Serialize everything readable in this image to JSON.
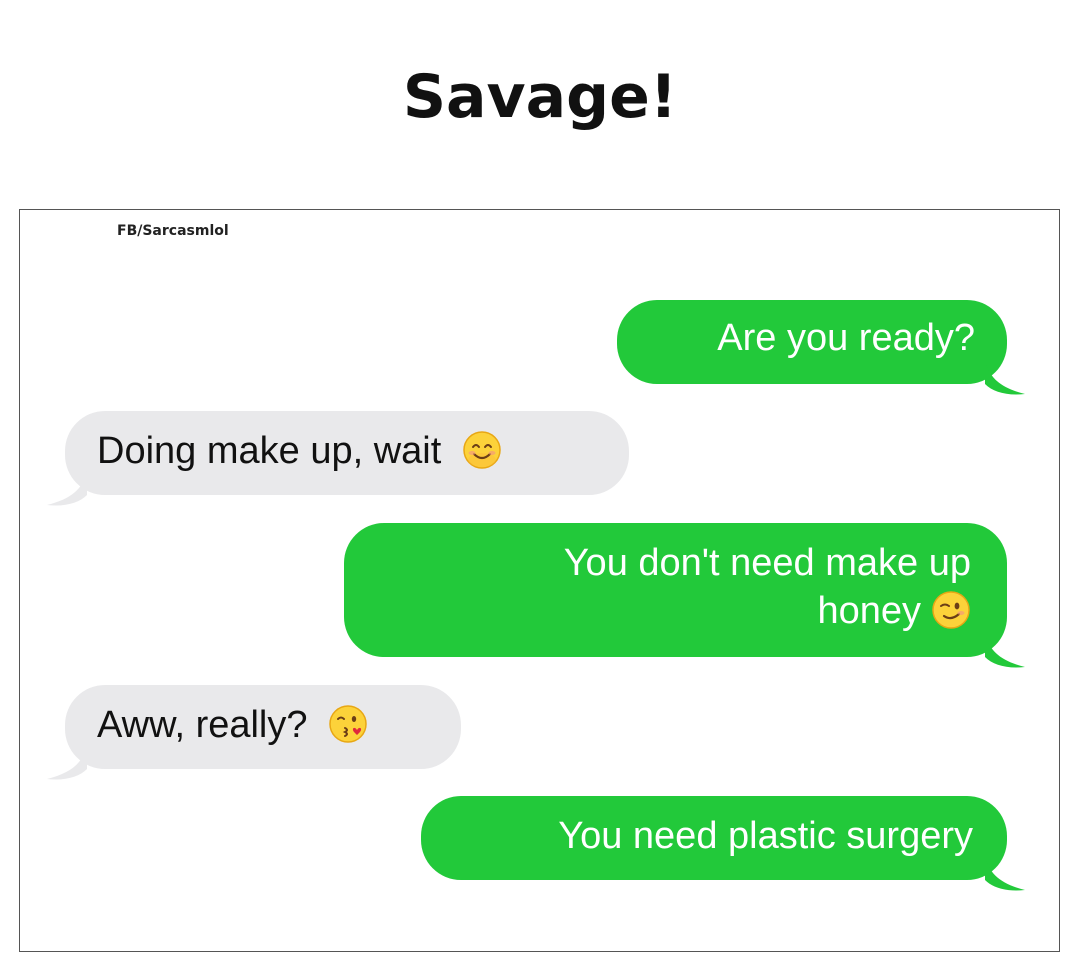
{
  "title": "Savage!",
  "watermark": "FB/Sarcasmlol",
  "colors": {
    "sent_bubble": "#22c93a",
    "received_bubble": "#e9e9eb",
    "sent_text": "#ffffff",
    "received_text": "#111111"
  },
  "messages": [
    {
      "direction": "sent",
      "text": "Are you ready?",
      "emoji": ""
    },
    {
      "direction": "received",
      "text": "Doing make up, wait",
      "emoji": "smiling-face-emoji"
    },
    {
      "direction": "sent",
      "line1": "You don't need make up",
      "line2": "honey",
      "emoji": "winking-face-emoji"
    },
    {
      "direction": "received",
      "text": "Aww, really?",
      "emoji": "face-blowing-kiss-emoji"
    },
    {
      "direction": "sent",
      "text": "You need plastic surgery",
      "emoji": ""
    }
  ]
}
